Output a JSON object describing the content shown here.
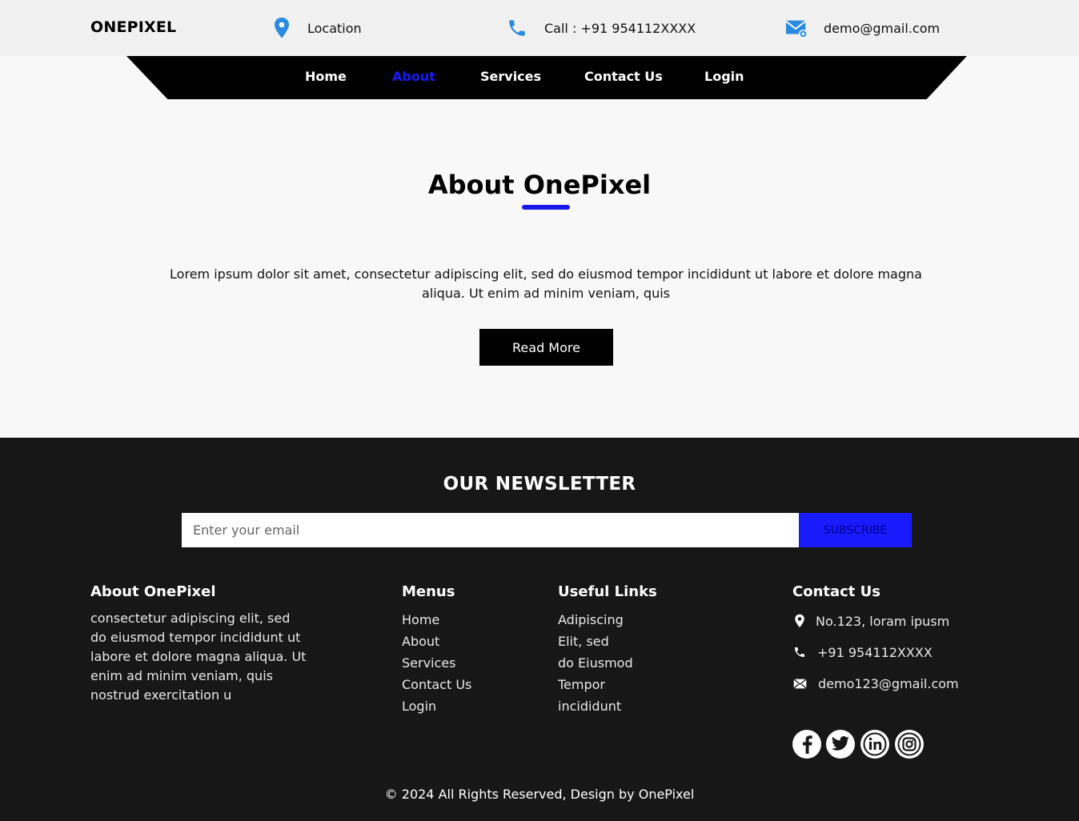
{
  "topbar": {
    "brand": "ONEPIXEL",
    "location": "Location",
    "call": "Call : +91 954112XXXX",
    "email": "demo@gmail.com",
    "icons": [
      "location-pin-icon",
      "phone-icon",
      "email-icon"
    ],
    "icon_color": "#2a8be0"
  },
  "nav": {
    "items": [
      "Home",
      "About",
      "Services",
      "Contact Us",
      "Login"
    ],
    "active": "About",
    "active_color": "#1a1aff"
  },
  "about": {
    "title": "About OnePixel",
    "text": "Lorem ipsum dolor sit amet, consectetur adipiscing elit, sed do eiusmod tempor incididunt ut labore et dolore magna aliqua. Ut enim ad minim veniam, quis",
    "button": "Read More",
    "underline_color": "#1a1ae6"
  },
  "newsletter": {
    "title": "OUR NEWSLETTER",
    "placeholder": "Enter your email",
    "button": "SUBSCRIBE",
    "button_color": "#1a1aff"
  },
  "footer": {
    "about": {
      "heading": "About OnePixel",
      "text": "consectetur adipiscing elit, sed do eiusmod tempor incididunt ut labore et dolore magna aliqua. Ut enim ad minim veniam, quis nostrud exercitation u"
    },
    "menus": {
      "heading": "Menus",
      "items": [
        "Home",
        "About",
        "Services",
        "Contact Us",
        "Login"
      ]
    },
    "useful_links": {
      "heading": "Useful Links",
      "items": [
        "Adipiscing",
        "Elit, sed",
        "do Eiusmod",
        "Tempor",
        "incididunt"
      ]
    },
    "contact": {
      "heading": "Contact Us",
      "address": "No.123, loram ipusm",
      "phone": "+91 954112XXXX",
      "email": "demo123@gmail.com"
    },
    "social": [
      "facebook-icon",
      "twitter-icon",
      "linkedin-icon",
      "instagram-icon"
    ],
    "copyright": "© 2024 All Rights Reserved, Design by OnePixel",
    "background": "#171717"
  }
}
